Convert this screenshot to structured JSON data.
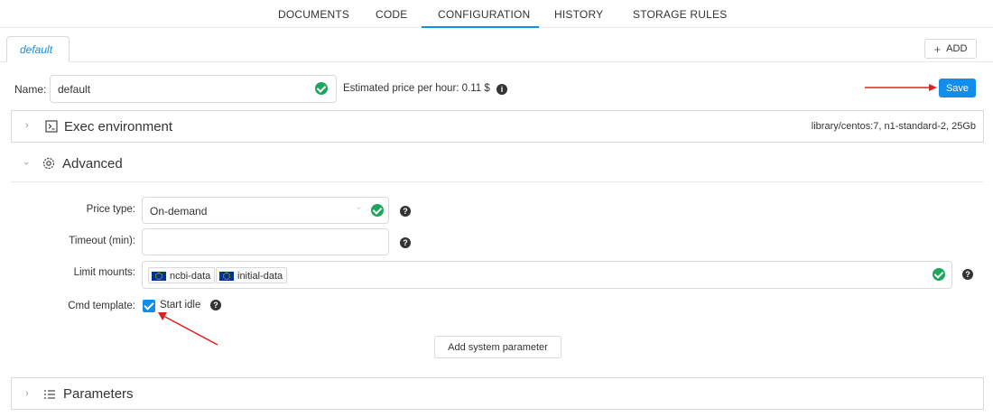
{
  "nav": {
    "tabs": [
      {
        "label": "DOCUMENTS"
      },
      {
        "label": "CODE"
      },
      {
        "label": "CONFIGURATION"
      },
      {
        "label": "HISTORY"
      },
      {
        "label": "STORAGE RULES"
      }
    ],
    "active_index": 2
  },
  "config_tab": {
    "label": "default"
  },
  "add_button": {
    "icon": "plus-icon",
    "label": "ADD"
  },
  "name_row": {
    "label": "Name:",
    "value": "default",
    "price_text": "Estimated price per hour: 0.11 $",
    "save_label": "Save"
  },
  "exec_panel": {
    "title": "Exec environment",
    "icon": "terminal-icon",
    "summary": "library/centos:7,  n1-standard-2,  25Gb"
  },
  "advanced_panel": {
    "title": "Advanced",
    "icon": "gear-icon",
    "price_type": {
      "label": "Price type",
      "value": "On-demand"
    },
    "timeout": {
      "label": "Timeout (min)",
      "value": ""
    },
    "limit_mounts": {
      "label": "Limit mounts",
      "tags": [
        "ncbi-data",
        "initial-data"
      ]
    },
    "cmd_template": {
      "label": "Cmd template",
      "checkbox_label": "Start idle",
      "checked": true
    },
    "add_system_param_label": "Add system parameter"
  },
  "params_panel": {
    "title": "Parameters",
    "icon": "list-icon"
  },
  "colors": {
    "accent": "#108ee9",
    "success": "#1fa55c",
    "annotation": "#e02020"
  }
}
